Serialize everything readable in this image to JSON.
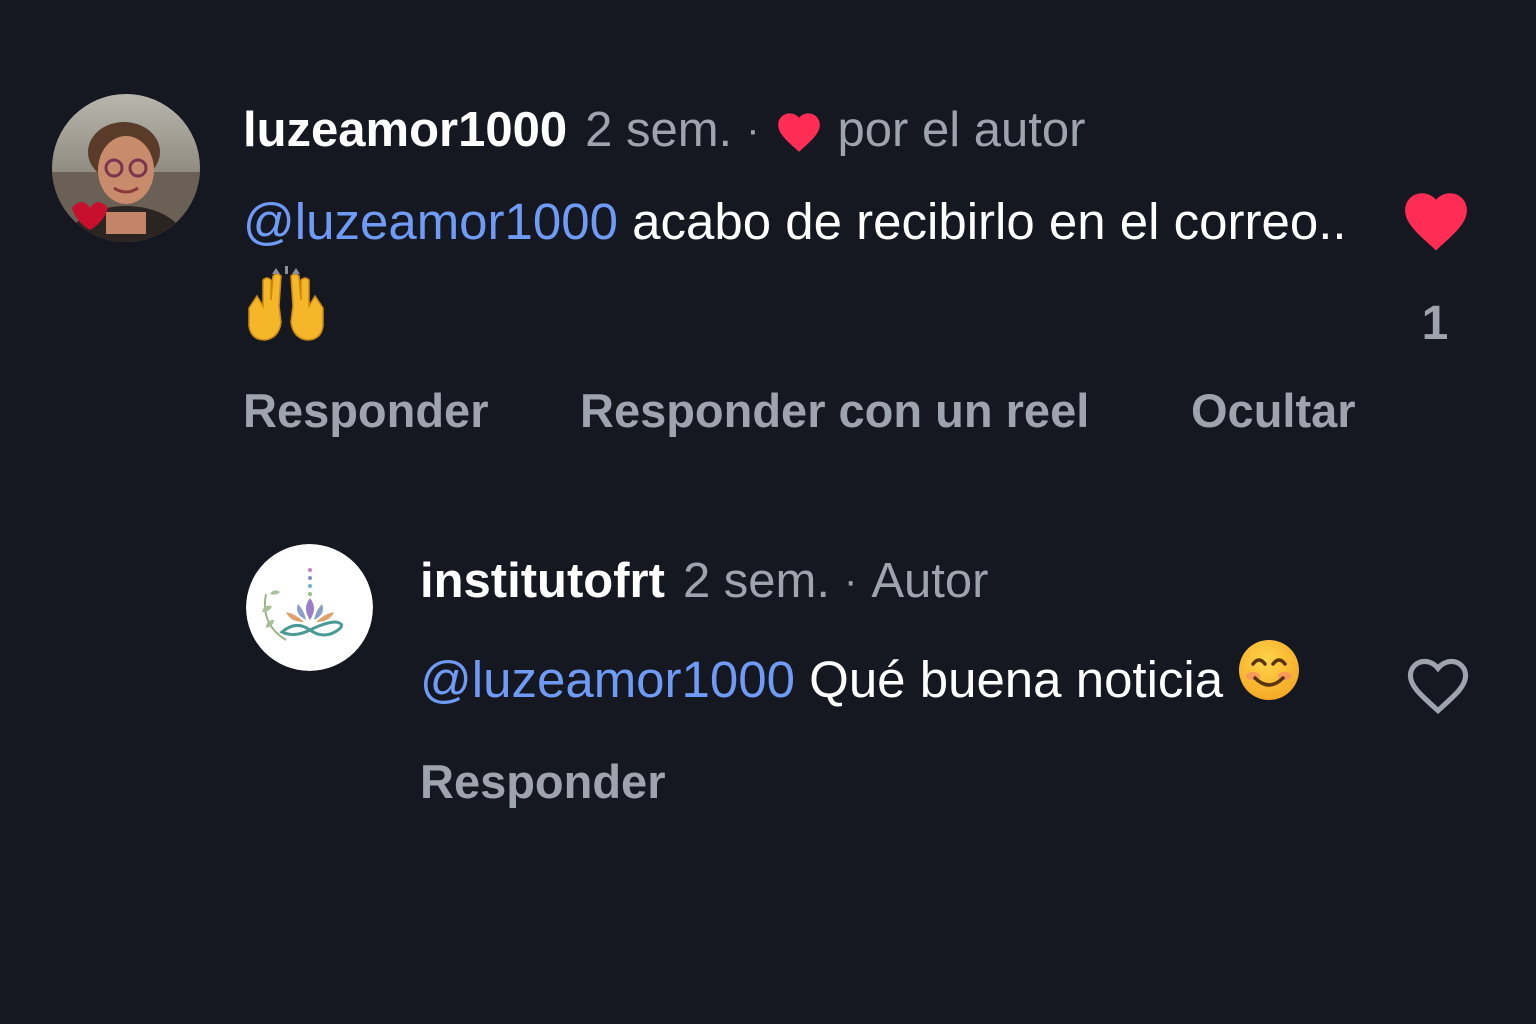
{
  "comments": [
    {
      "username": "luzeamor1000",
      "time": "2 sem.",
      "separator": "·",
      "meta_label": "por el autor",
      "mention": "@luzeamor1000",
      "text": " acabo de recibirlo en el correo.. ",
      "emoji": "raising-hands",
      "like_state": "liked",
      "like_count": "1",
      "actions": [
        "Responder",
        "Responder con un reel",
        "Ocultar"
      ],
      "colors": {
        "heart": "#ff2d55"
      }
    },
    {
      "username": "institutofrt",
      "time": "2 sem.",
      "separator": "·",
      "meta_label": "Autor",
      "mention": "@luzeamor1000",
      "text": " Qué buena noticia ",
      "emoji": "smiling-face",
      "like_state": "not-liked",
      "actions": [
        "Responder"
      ]
    }
  ],
  "theme": {
    "background": "#151820",
    "muted_text": "#9ea3ad",
    "mention": "#6f9af6"
  }
}
